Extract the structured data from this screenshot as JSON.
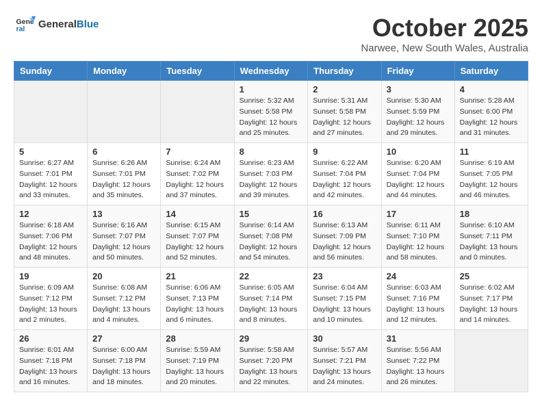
{
  "header": {
    "logo_line1": "General",
    "logo_line2": "Blue",
    "month": "October 2025",
    "location": "Narwee, New South Wales, Australia"
  },
  "days_of_week": [
    "Sunday",
    "Monday",
    "Tuesday",
    "Wednesday",
    "Thursday",
    "Friday",
    "Saturday"
  ],
  "weeks": [
    [
      {
        "num": "",
        "info": ""
      },
      {
        "num": "",
        "info": ""
      },
      {
        "num": "",
        "info": ""
      },
      {
        "num": "1",
        "info": "Sunrise: 5:32 AM\nSunset: 5:58 PM\nDaylight: 12 hours\nand 25 minutes."
      },
      {
        "num": "2",
        "info": "Sunrise: 5:31 AM\nSunset: 5:58 PM\nDaylight: 12 hours\nand 27 minutes."
      },
      {
        "num": "3",
        "info": "Sunrise: 5:30 AM\nSunset: 5:59 PM\nDaylight: 12 hours\nand 29 minutes."
      },
      {
        "num": "4",
        "info": "Sunrise: 5:28 AM\nSunset: 6:00 PM\nDaylight: 12 hours\nand 31 minutes."
      }
    ],
    [
      {
        "num": "5",
        "info": "Sunrise: 6:27 AM\nSunset: 7:01 PM\nDaylight: 12 hours\nand 33 minutes."
      },
      {
        "num": "6",
        "info": "Sunrise: 6:26 AM\nSunset: 7:01 PM\nDaylight: 12 hours\nand 35 minutes."
      },
      {
        "num": "7",
        "info": "Sunrise: 6:24 AM\nSunset: 7:02 PM\nDaylight: 12 hours\nand 37 minutes."
      },
      {
        "num": "8",
        "info": "Sunrise: 6:23 AM\nSunset: 7:03 PM\nDaylight: 12 hours\nand 39 minutes."
      },
      {
        "num": "9",
        "info": "Sunrise: 6:22 AM\nSunset: 7:04 PM\nDaylight: 12 hours\nand 42 minutes."
      },
      {
        "num": "10",
        "info": "Sunrise: 6:20 AM\nSunset: 7:04 PM\nDaylight: 12 hours\nand 44 minutes."
      },
      {
        "num": "11",
        "info": "Sunrise: 6:19 AM\nSunset: 7:05 PM\nDaylight: 12 hours\nand 46 minutes."
      }
    ],
    [
      {
        "num": "12",
        "info": "Sunrise: 6:18 AM\nSunset: 7:06 PM\nDaylight: 12 hours\nand 48 minutes."
      },
      {
        "num": "13",
        "info": "Sunrise: 6:16 AM\nSunset: 7:07 PM\nDaylight: 12 hours\nand 50 minutes."
      },
      {
        "num": "14",
        "info": "Sunrise: 6:15 AM\nSunset: 7:07 PM\nDaylight: 12 hours\nand 52 minutes."
      },
      {
        "num": "15",
        "info": "Sunrise: 6:14 AM\nSunset: 7:08 PM\nDaylight: 12 hours\nand 54 minutes."
      },
      {
        "num": "16",
        "info": "Sunrise: 6:13 AM\nSunset: 7:09 PM\nDaylight: 12 hours\nand 56 minutes."
      },
      {
        "num": "17",
        "info": "Sunrise: 6:11 AM\nSunset: 7:10 PM\nDaylight: 12 hours\nand 58 minutes."
      },
      {
        "num": "18",
        "info": "Sunrise: 6:10 AM\nSunset: 7:11 PM\nDaylight: 13 hours\nand 0 minutes."
      }
    ],
    [
      {
        "num": "19",
        "info": "Sunrise: 6:09 AM\nSunset: 7:12 PM\nDaylight: 13 hours\nand 2 minutes."
      },
      {
        "num": "20",
        "info": "Sunrise: 6:08 AM\nSunset: 7:12 PM\nDaylight: 13 hours\nand 4 minutes."
      },
      {
        "num": "21",
        "info": "Sunrise: 6:06 AM\nSunset: 7:13 PM\nDaylight: 13 hours\nand 6 minutes."
      },
      {
        "num": "22",
        "info": "Sunrise: 6:05 AM\nSunset: 7:14 PM\nDaylight: 13 hours\nand 8 minutes."
      },
      {
        "num": "23",
        "info": "Sunrise: 6:04 AM\nSunset: 7:15 PM\nDaylight: 13 hours\nand 10 minutes."
      },
      {
        "num": "24",
        "info": "Sunrise: 6:03 AM\nSunset: 7:16 PM\nDaylight: 13 hours\nand 12 minutes."
      },
      {
        "num": "25",
        "info": "Sunrise: 6:02 AM\nSunset: 7:17 PM\nDaylight: 13 hours\nand 14 minutes."
      }
    ],
    [
      {
        "num": "26",
        "info": "Sunrise: 6:01 AM\nSunset: 7:18 PM\nDaylight: 13 hours\nand 16 minutes."
      },
      {
        "num": "27",
        "info": "Sunrise: 6:00 AM\nSunset: 7:18 PM\nDaylight: 13 hours\nand 18 minutes."
      },
      {
        "num": "28",
        "info": "Sunrise: 5:59 AM\nSunset: 7:19 PM\nDaylight: 13 hours\nand 20 minutes."
      },
      {
        "num": "29",
        "info": "Sunrise: 5:58 AM\nSunset: 7:20 PM\nDaylight: 13 hours\nand 22 minutes."
      },
      {
        "num": "30",
        "info": "Sunrise: 5:57 AM\nSunset: 7:21 PM\nDaylight: 13 hours\nand 24 minutes."
      },
      {
        "num": "31",
        "info": "Sunrise: 5:56 AM\nSunset: 7:22 PM\nDaylight: 13 hours\nand 26 minutes."
      },
      {
        "num": "",
        "info": ""
      }
    ]
  ]
}
